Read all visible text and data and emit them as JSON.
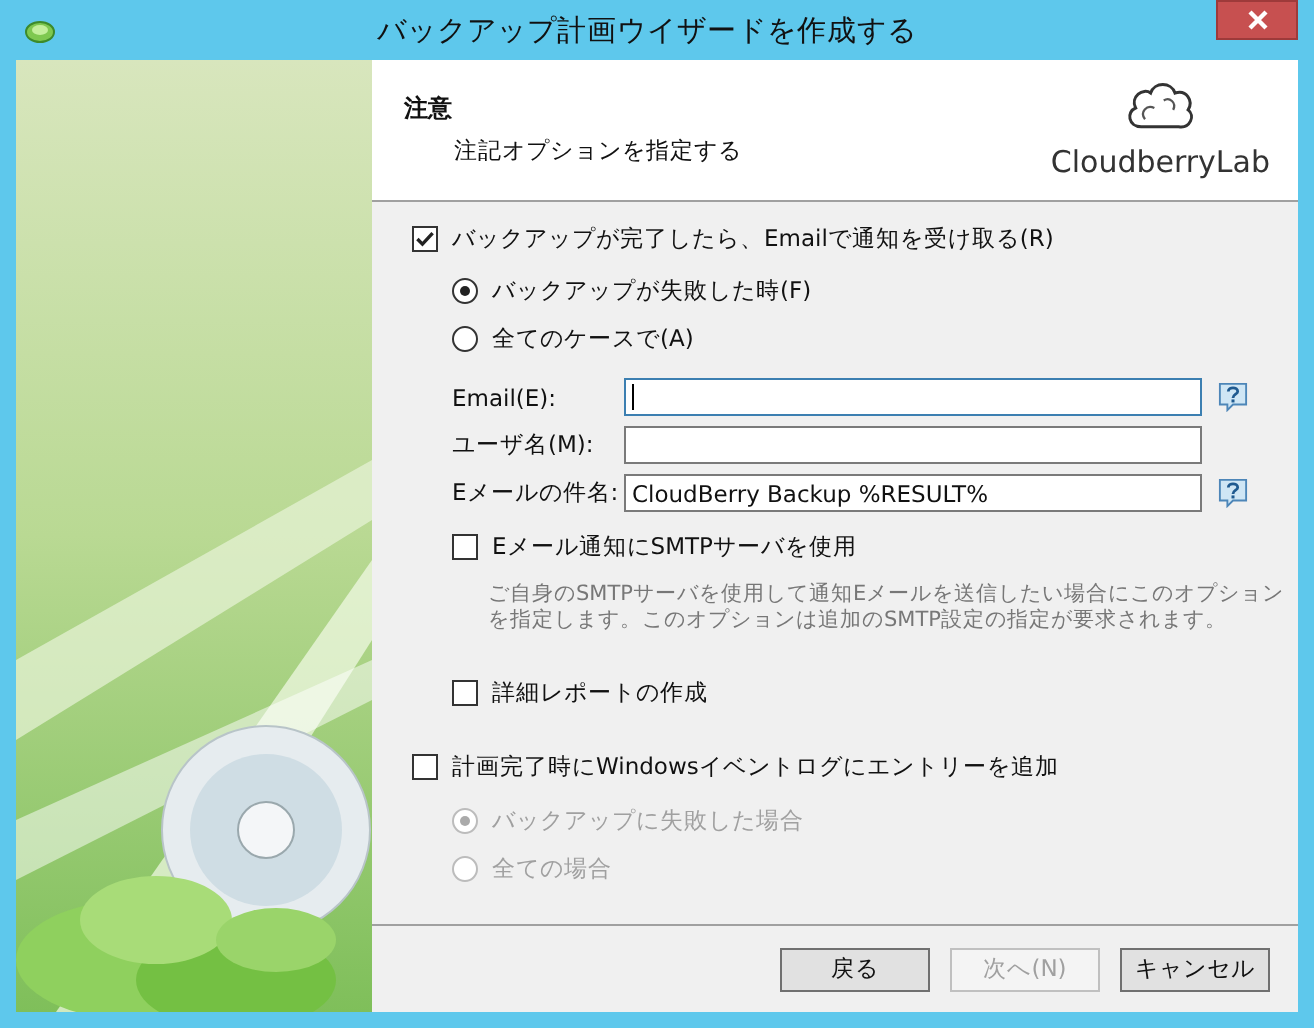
{
  "window": {
    "title": "バックアップ計画ウイザードを作成する"
  },
  "header": {
    "title": "注意",
    "subtitle": "注記オプションを指定する",
    "logo": "CloudberryLab"
  },
  "notify": {
    "label": "バックアップが完了したら、Emailで通知を受け取る(R)",
    "checked": true
  },
  "notify_when": [
    {
      "label": "バックアップが失敗した時(F)",
      "selected": true,
      "disabled": false
    },
    {
      "label": "全てのケースで(A)",
      "selected": false,
      "disabled": false
    }
  ],
  "fields": [
    {
      "label": "Email(E):",
      "focused": true,
      "help": true
    },
    {
      "label": "ユーザ名(M):",
      "focused": false,
      "help": false
    },
    {
      "label": "Eメールの件名:",
      "value": "CloudBerry Backup %RESULT%",
      "focused": false,
      "help": true
    }
  ],
  "smtp": {
    "label": "Eメール通知にSMTPサーバを使用",
    "checked": false,
    "note": "ご自身のSMTPサーバを使用して通知Eメールを送信したい場合にこのオプションを指定します。このオプションは追加のSMTP設定の指定が要求されます。"
  },
  "detailed_report": {
    "label": "詳細レポートの作成",
    "checked": false
  },
  "eventlog": {
    "label": "計画完了時にWindowsイベントログにエントリーを追加",
    "checked": false
  },
  "eventlog_when": [
    {
      "label": "バックアップに失敗した場合",
      "selected": true,
      "disabled": true
    },
    {
      "label": "全ての場合",
      "selected": false,
      "disabled": true
    }
  ],
  "buttons": [
    {
      "label": "戻る",
      "disabled": false
    },
    {
      "label": "次へ(N)",
      "disabled": true
    },
    {
      "label": "キャンセル",
      "disabled": false
    }
  ]
}
